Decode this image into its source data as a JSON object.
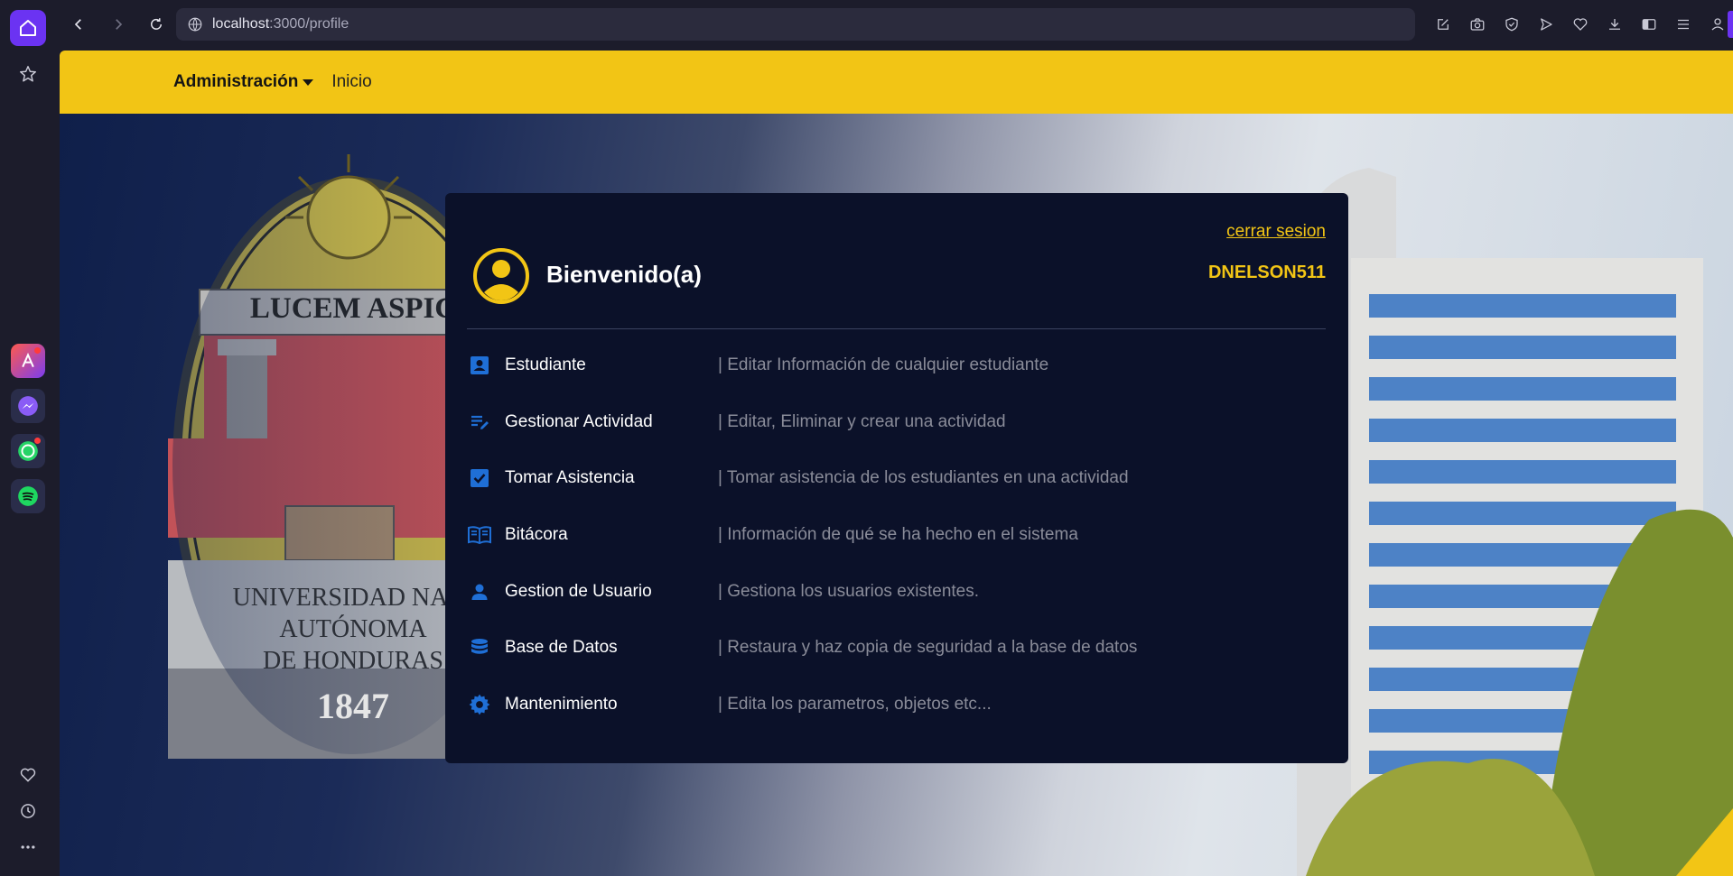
{
  "browser": {
    "url_host": "localhost",
    "url_path": ":3000/profile",
    "sidebar_apps": [
      "home-icon",
      "star-icon",
      "aria-icon",
      "messenger-icon",
      "whatsapp-icon",
      "spotify-icon",
      "heart-icon",
      "history-icon",
      "more-icon"
    ]
  },
  "navbar": {
    "admin_label": "Administración",
    "home_label": "Inicio"
  },
  "profile": {
    "logout_label": "cerrar sesion",
    "welcome": "Bienvenido(a)",
    "username": "DNELSON511"
  },
  "menu": [
    {
      "label": "Estudiante",
      "desc": "| Editar Información de cualquier estudiante",
      "icon": "student-card-icon"
    },
    {
      "label": "Gestionar Actividad",
      "desc": "| Editar, Eliminar y crear una actividad",
      "icon": "edit-list-icon"
    },
    {
      "label": "Tomar Asistencia",
      "desc": "| Tomar asistencia de los estudiantes en una actividad",
      "icon": "checkbox-icon"
    },
    {
      "label": "Bitácora",
      "desc": "| Información de qué se ha hecho en el sistema",
      "icon": "book-icon"
    },
    {
      "label": "Gestion de Usuario",
      "desc": "| Gestiona los usuarios existentes.",
      "icon": "user-icon"
    },
    {
      "label": "Base de Datos",
      "desc": "| Restaura y haz copia de seguridad a la base de datos",
      "icon": "database-icon"
    },
    {
      "label": "Mantenimiento",
      "desc": "| Edita los parametros, objetos etc...",
      "icon": "gear-icon"
    }
  ],
  "hero": {
    "seal_motto": "LUCEM ASPIC",
    "seal_line1": "UNIVERSIDAD NACI",
    "seal_line2": "AUTÓNOMA",
    "seal_line3": "DE HONDURAS",
    "seal_year": "1847"
  },
  "colors": {
    "accent": "#f2c515",
    "card": "#0b1129",
    "icon_blue": "#1f6fd6",
    "browser_purple": "#6b33f2"
  }
}
